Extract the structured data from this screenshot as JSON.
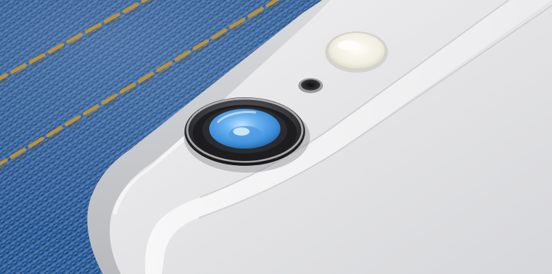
{
  "image": {
    "subject": "phone-rear-camera-on-denim",
    "colors": {
      "denim_dark": "#12315a",
      "denim_mid": "#2d5f9c",
      "denim_light": "#7fa6d2",
      "stitch": "#c9962e",
      "phone_body": "#e6e6e8",
      "phone_edge": "#cfd0d3",
      "antenna_band": "#f3f3f4",
      "lens_ring": "#2b2b2d",
      "lens_glass": "#5ea8ea",
      "flash": "#f4f1e6"
    }
  }
}
